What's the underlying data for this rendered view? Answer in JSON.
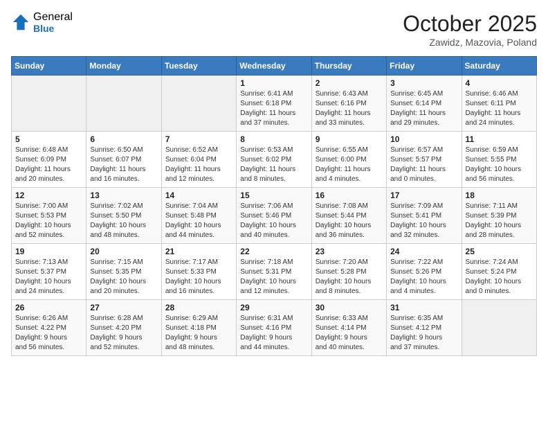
{
  "logo": {
    "general": "General",
    "blue": "Blue"
  },
  "header": {
    "month": "October 2025",
    "location": "Zawidz, Mazovia, Poland"
  },
  "days": [
    "Sunday",
    "Monday",
    "Tuesday",
    "Wednesday",
    "Thursday",
    "Friday",
    "Saturday"
  ],
  "weeks": [
    [
      {
        "date": "",
        "info": ""
      },
      {
        "date": "",
        "info": ""
      },
      {
        "date": "",
        "info": ""
      },
      {
        "date": "1",
        "info": "Sunrise: 6:41 AM\nSunset: 6:18 PM\nDaylight: 11 hours\nand 37 minutes."
      },
      {
        "date": "2",
        "info": "Sunrise: 6:43 AM\nSunset: 6:16 PM\nDaylight: 11 hours\nand 33 minutes."
      },
      {
        "date": "3",
        "info": "Sunrise: 6:45 AM\nSunset: 6:14 PM\nDaylight: 11 hours\nand 29 minutes."
      },
      {
        "date": "4",
        "info": "Sunrise: 6:46 AM\nSunset: 6:11 PM\nDaylight: 11 hours\nand 24 minutes."
      }
    ],
    [
      {
        "date": "5",
        "info": "Sunrise: 6:48 AM\nSunset: 6:09 PM\nDaylight: 11 hours\nand 20 minutes."
      },
      {
        "date": "6",
        "info": "Sunrise: 6:50 AM\nSunset: 6:07 PM\nDaylight: 11 hours\nand 16 minutes."
      },
      {
        "date": "7",
        "info": "Sunrise: 6:52 AM\nSunset: 6:04 PM\nDaylight: 11 hours\nand 12 minutes."
      },
      {
        "date": "8",
        "info": "Sunrise: 6:53 AM\nSunset: 6:02 PM\nDaylight: 11 hours\nand 8 minutes."
      },
      {
        "date": "9",
        "info": "Sunrise: 6:55 AM\nSunset: 6:00 PM\nDaylight: 11 hours\nand 4 minutes."
      },
      {
        "date": "10",
        "info": "Sunrise: 6:57 AM\nSunset: 5:57 PM\nDaylight: 11 hours\nand 0 minutes."
      },
      {
        "date": "11",
        "info": "Sunrise: 6:59 AM\nSunset: 5:55 PM\nDaylight: 10 hours\nand 56 minutes."
      }
    ],
    [
      {
        "date": "12",
        "info": "Sunrise: 7:00 AM\nSunset: 5:53 PM\nDaylight: 10 hours\nand 52 minutes."
      },
      {
        "date": "13",
        "info": "Sunrise: 7:02 AM\nSunset: 5:50 PM\nDaylight: 10 hours\nand 48 minutes."
      },
      {
        "date": "14",
        "info": "Sunrise: 7:04 AM\nSunset: 5:48 PM\nDaylight: 10 hours\nand 44 minutes."
      },
      {
        "date": "15",
        "info": "Sunrise: 7:06 AM\nSunset: 5:46 PM\nDaylight: 10 hours\nand 40 minutes."
      },
      {
        "date": "16",
        "info": "Sunrise: 7:08 AM\nSunset: 5:44 PM\nDaylight: 10 hours\nand 36 minutes."
      },
      {
        "date": "17",
        "info": "Sunrise: 7:09 AM\nSunset: 5:41 PM\nDaylight: 10 hours\nand 32 minutes."
      },
      {
        "date": "18",
        "info": "Sunrise: 7:11 AM\nSunset: 5:39 PM\nDaylight: 10 hours\nand 28 minutes."
      }
    ],
    [
      {
        "date": "19",
        "info": "Sunrise: 7:13 AM\nSunset: 5:37 PM\nDaylight: 10 hours\nand 24 minutes."
      },
      {
        "date": "20",
        "info": "Sunrise: 7:15 AM\nSunset: 5:35 PM\nDaylight: 10 hours\nand 20 minutes."
      },
      {
        "date": "21",
        "info": "Sunrise: 7:17 AM\nSunset: 5:33 PM\nDaylight: 10 hours\nand 16 minutes."
      },
      {
        "date": "22",
        "info": "Sunrise: 7:18 AM\nSunset: 5:31 PM\nDaylight: 10 hours\nand 12 minutes."
      },
      {
        "date": "23",
        "info": "Sunrise: 7:20 AM\nSunset: 5:28 PM\nDaylight: 10 hours\nand 8 minutes."
      },
      {
        "date": "24",
        "info": "Sunrise: 7:22 AM\nSunset: 5:26 PM\nDaylight: 10 hours\nand 4 minutes."
      },
      {
        "date": "25",
        "info": "Sunrise: 7:24 AM\nSunset: 5:24 PM\nDaylight: 10 hours\nand 0 minutes."
      }
    ],
    [
      {
        "date": "26",
        "info": "Sunrise: 6:26 AM\nSunset: 4:22 PM\nDaylight: 9 hours\nand 56 minutes."
      },
      {
        "date": "27",
        "info": "Sunrise: 6:28 AM\nSunset: 4:20 PM\nDaylight: 9 hours\nand 52 minutes."
      },
      {
        "date": "28",
        "info": "Sunrise: 6:29 AM\nSunset: 4:18 PM\nDaylight: 9 hours\nand 48 minutes."
      },
      {
        "date": "29",
        "info": "Sunrise: 6:31 AM\nSunset: 4:16 PM\nDaylight: 9 hours\nand 44 minutes."
      },
      {
        "date": "30",
        "info": "Sunrise: 6:33 AM\nSunset: 4:14 PM\nDaylight: 9 hours\nand 40 minutes."
      },
      {
        "date": "31",
        "info": "Sunrise: 6:35 AM\nSunset: 4:12 PM\nDaylight: 9 hours\nand 37 minutes."
      },
      {
        "date": "",
        "info": ""
      }
    ]
  ]
}
